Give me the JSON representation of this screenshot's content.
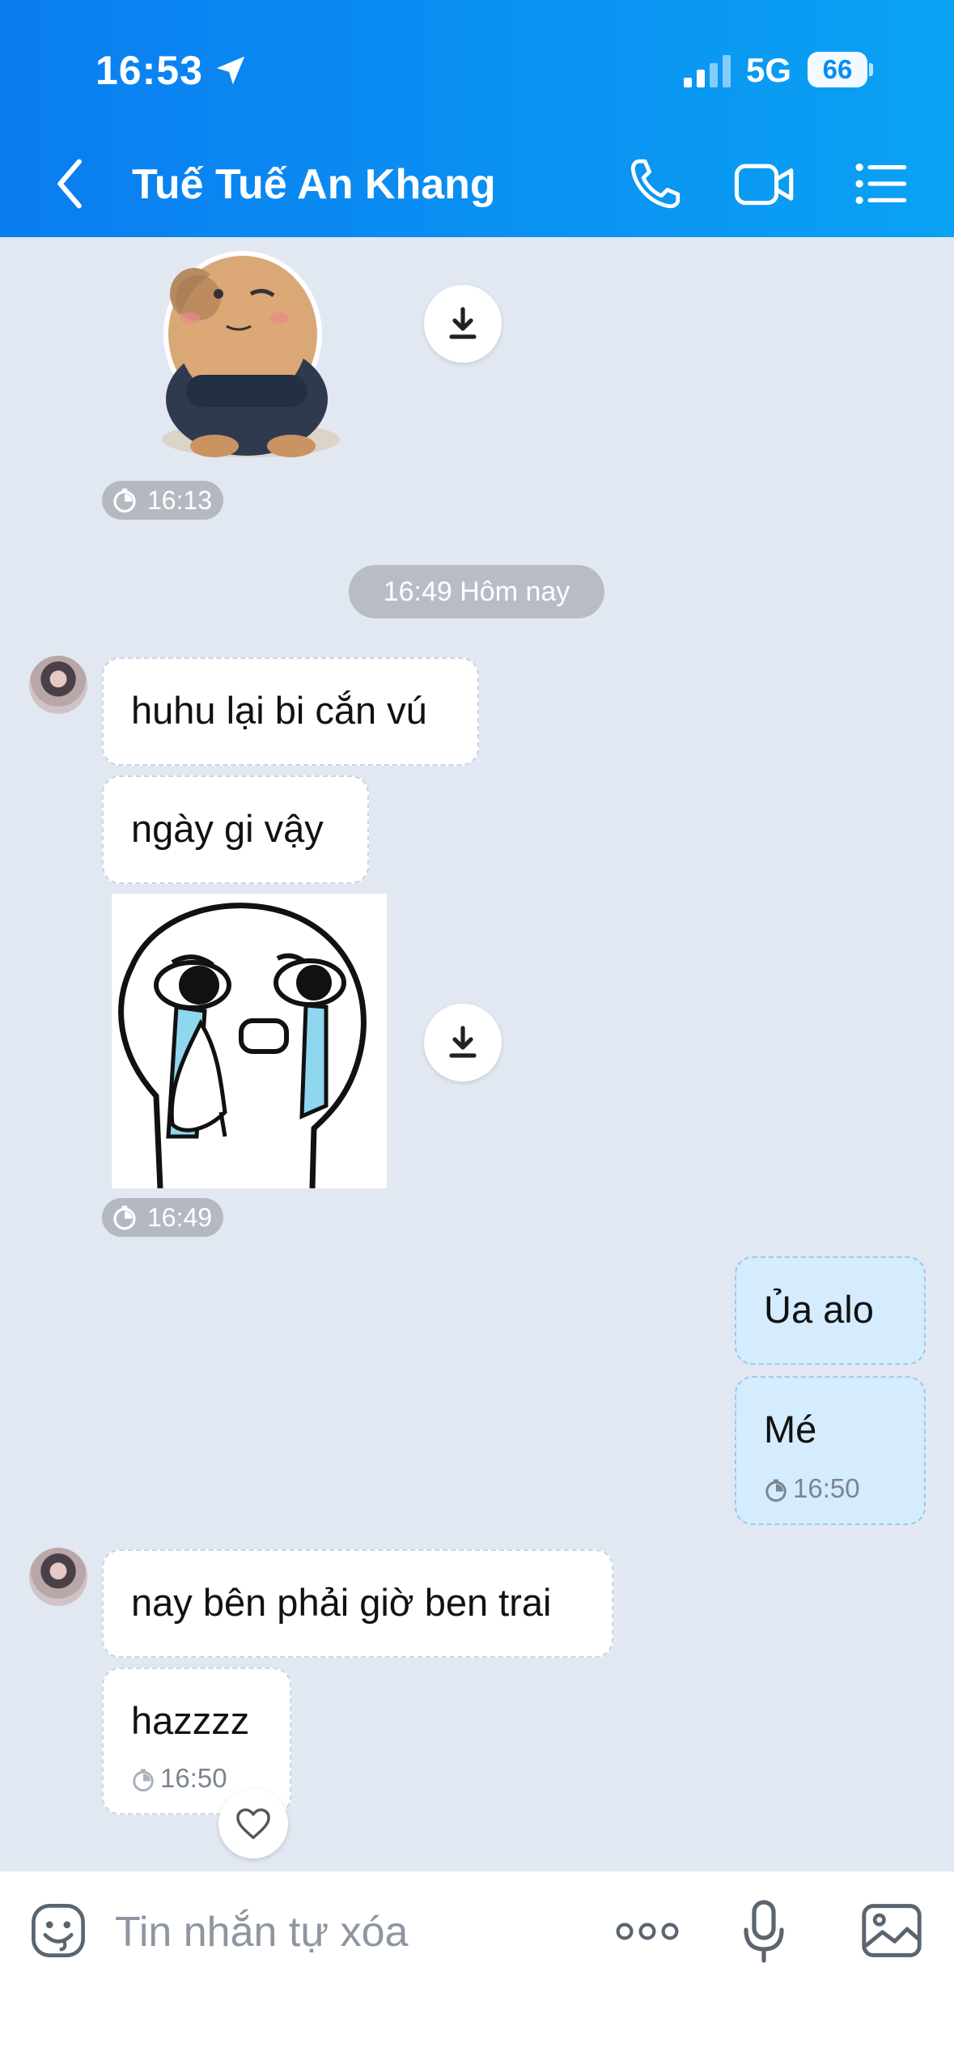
{
  "status_bar": {
    "time": "16:53",
    "network": "5G",
    "battery": "66",
    "icons": [
      "location-arrow-icon",
      "signal-bars-icon",
      "battery-icon"
    ]
  },
  "header": {
    "title": "Tuế Tuế An Khang",
    "icons": [
      "back-chevron-icon",
      "phone-call-icon",
      "video-call-icon",
      "list-menu-icon"
    ],
    "accent_color": "#0a8cf1"
  },
  "messages": {
    "sticker1_time": "16:13",
    "date_separator": "16:49 Hôm nay",
    "msg1": "huhu lại bi cắn vú",
    "msg2": "ngày gi vậy",
    "sticker2_time": "16:49",
    "msg3_mine": "Ủa alo",
    "msg4_mine": "Mé",
    "msg4_time": "16:50",
    "msg5": "nay bên phải giờ ben trai",
    "msg6": "hazzzz",
    "msg6_time": "16:50"
  },
  "composer": {
    "placeholder": "Tin nhắn tự xóa",
    "icons": [
      "emoji-icon",
      "more-dots-icon",
      "microphone-icon",
      "image-icon"
    ]
  },
  "colors": {
    "chat_background": "#e2e8f1",
    "incoming_bubble": "#ffffff",
    "outgoing_bubble": "#d4ecfd"
  }
}
